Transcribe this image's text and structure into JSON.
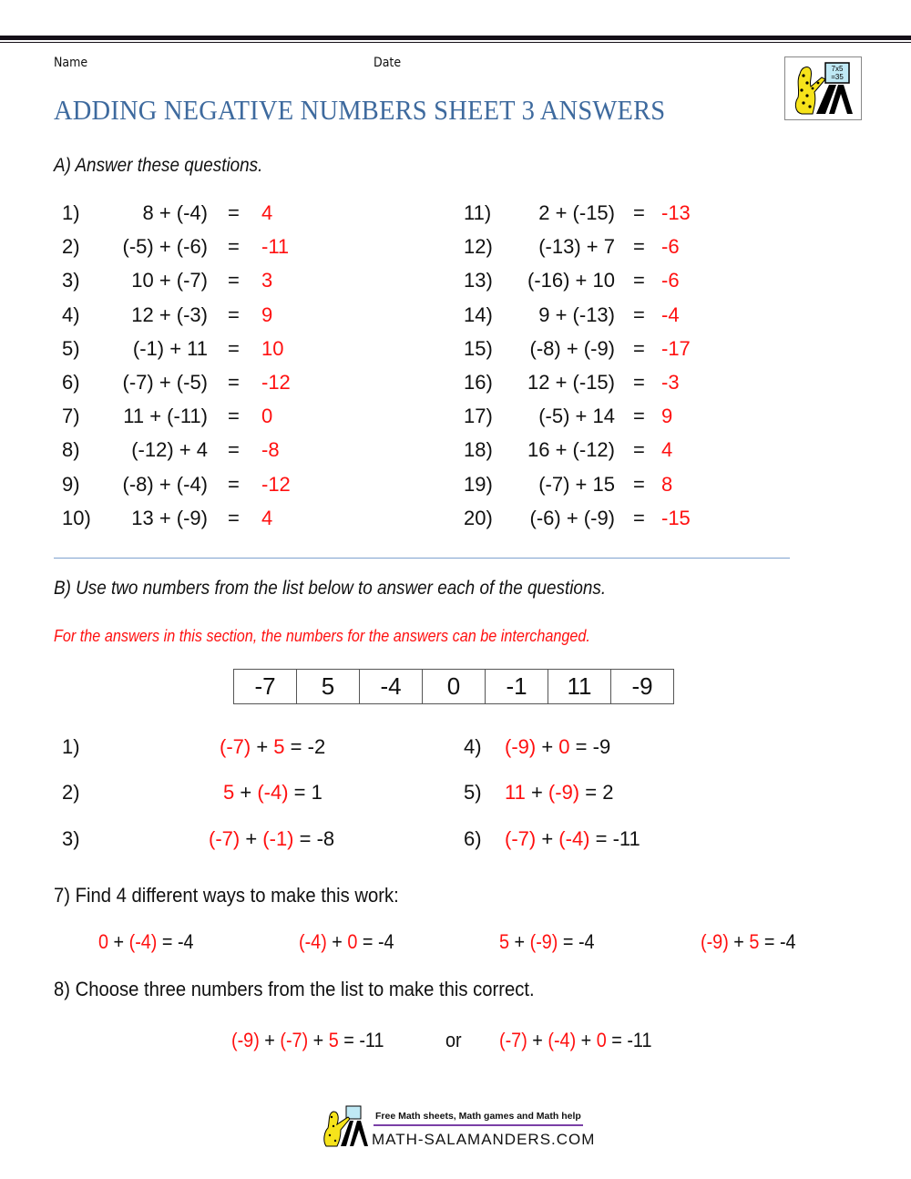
{
  "header": {
    "name_label": "Name",
    "date_label": "Date",
    "title": "ADDING NEGATIVE NUMBERS SHEET 3 ANSWERS",
    "logo_text_top": "7x5",
    "logo_text_bottom": "=35"
  },
  "section_a": {
    "heading": "A) Answer these questions.",
    "left": [
      {
        "num": "1)",
        "expr": "8 + (-4)",
        "eq": "=",
        "ans": "4"
      },
      {
        "num": "2)",
        "expr": "(-5) + (-6)",
        "eq": "=",
        "ans": "-11"
      },
      {
        "num": "3)",
        "expr": "10 + (-7)",
        "eq": "=",
        "ans": "3"
      },
      {
        "num": "4)",
        "expr": "12 + (-3)",
        "eq": "=",
        "ans": "9"
      },
      {
        "num": "5)",
        "expr": "(-1) + 11",
        "eq": "=",
        "ans": "10"
      },
      {
        "num": "6)",
        "expr": "(-7) + (-5)",
        "eq": "=",
        "ans": "-12"
      },
      {
        "num": "7)",
        "expr": "11 + (-11)",
        "eq": "=",
        "ans": "0"
      },
      {
        "num": "8)",
        "expr": "(-12) + 4",
        "eq": "=",
        "ans": "-8"
      },
      {
        "num": "9)",
        "expr": "(-8) + (-4)",
        "eq": "=",
        "ans": "-12"
      },
      {
        "num": "10)",
        "expr": "13 + (-9)",
        "eq": "=",
        "ans": "4"
      }
    ],
    "right": [
      {
        "num": "11)",
        "expr": "2 + (-15)",
        "eq": "=",
        "ans": "-13"
      },
      {
        "num": "12)",
        "expr": "(-13) + 7",
        "eq": "=",
        "ans": "-6"
      },
      {
        "num": "13)",
        "expr": "(-16) + 10",
        "eq": "=",
        "ans": "-6"
      },
      {
        "num": "14)",
        "expr": "9 + (-13)",
        "eq": "=",
        "ans": "-4"
      },
      {
        "num": "15)",
        "expr": "(-8) + (-9)",
        "eq": "=",
        "ans": "-17"
      },
      {
        "num": "16)",
        "expr": "12 + (-15)",
        "eq": "=",
        "ans": "-3"
      },
      {
        "num": "17)",
        "expr": "(-5) + 14",
        "eq": "=",
        "ans": "9"
      },
      {
        "num": "18)",
        "expr": "16 + (-12)",
        "eq": "=",
        "ans": "4"
      },
      {
        "num": "19)",
        "expr": "(-7) + 15",
        "eq": "=",
        "ans": "8"
      },
      {
        "num": "20)",
        "expr": "(-6) + (-9)",
        "eq": "=",
        "ans": "-15"
      }
    ]
  },
  "section_b": {
    "heading": "B) Use two numbers from the list below to answer each of the questions.",
    "note": "For the answers in this section, the numbers for the answers can be interchanged.",
    "number_list": [
      "-7",
      "5",
      "-4",
      "0",
      "-1",
      "11",
      "-9"
    ],
    "questions": [
      {
        "num": "1)",
        "a": "(-7)",
        "plus": " + ",
        "b": "5",
        "rest": " = -2"
      },
      {
        "num": "2)",
        "a": "5",
        "plus": " + ",
        "b": "(-4)",
        "rest": " = 1"
      },
      {
        "num": "3)",
        "a": "(-7)",
        "plus": " + ",
        "b": "(-1)",
        "rest": " = -8"
      },
      {
        "num": "4)",
        "a": "(-9)",
        "plus": " + ",
        "b": "0",
        "rest": " = -9"
      },
      {
        "num": "5)",
        "a": "11",
        "plus": " + ",
        "b": "(-9)",
        "rest": " = 2"
      },
      {
        "num": "6)",
        "a": "(-7)",
        "plus": " + ",
        "b": "(-4)",
        "rest": " = -11"
      }
    ],
    "q7": {
      "prompt": "7) Find 4 different ways to make this work:",
      "ways": [
        {
          "a": "0",
          "plus": " + ",
          "b": "(-4)",
          "rest": " = -4"
        },
        {
          "a": "(-4)",
          "plus": " + ",
          "b": "0",
          "rest": " = -4"
        },
        {
          "a": "5",
          "plus": " + ",
          "b": "(-9)",
          "rest": " = -4"
        },
        {
          "a": "(-9)",
          "plus": " + ",
          "b": "5",
          "rest": " = -4"
        }
      ]
    },
    "q8": {
      "prompt": "8) Choose three numbers from the list to make this correct.",
      "answer1": {
        "a": "(-9)",
        "p1": " + ",
        "b": "(-7)",
        "p2": " + ",
        "c": "5",
        "rest": " = -11"
      },
      "or": "or",
      "answer2": {
        "a": "(-7)",
        "p1": " + ",
        "b": "(-4)",
        "p2": " + ",
        "c": "0",
        "rest": " = -11"
      }
    }
  },
  "footer": {
    "tagline": "Free Math sheets, Math games and Math help",
    "site": "MATH-SALAMANDERS.COM"
  },
  "colors": {
    "title": "#3e6a9e",
    "answer": "#ff1010",
    "divider": "#7fa2cf"
  }
}
